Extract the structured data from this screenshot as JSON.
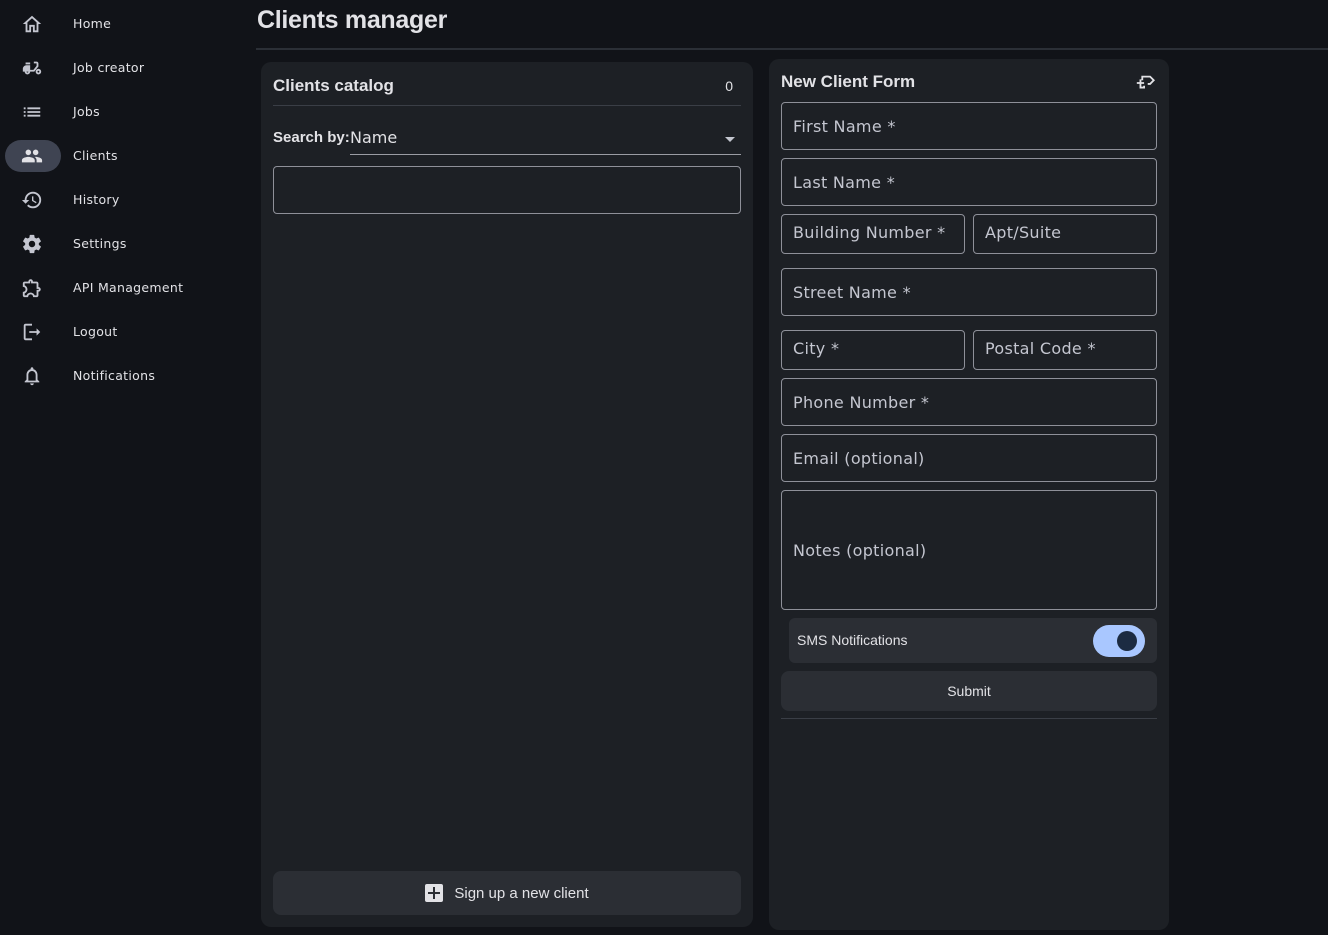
{
  "page": {
    "title": "Clients manager"
  },
  "sidebar": {
    "items": [
      {
        "label": "Home",
        "icon": "home-icon"
      },
      {
        "label": "Job creator",
        "icon": "moped-icon"
      },
      {
        "label": "Jobs",
        "icon": "list-icon"
      },
      {
        "label": "Clients",
        "icon": "people-icon",
        "active": true
      },
      {
        "label": "History",
        "icon": "history-icon"
      },
      {
        "label": "Settings",
        "icon": "gear-icon"
      },
      {
        "label": "API Management",
        "icon": "extension-icon"
      },
      {
        "label": "Logout",
        "icon": "logout-icon"
      },
      {
        "label": "Notifications",
        "icon": "bell-icon"
      }
    ]
  },
  "catalog": {
    "title": "Clients catalog",
    "count": "0",
    "search_label": "Search by:",
    "search_by": "Name",
    "search_value": "",
    "signup_label": "Sign up a new client"
  },
  "form": {
    "title": "New Client Form",
    "corner_icon": "delivery-add-icon",
    "first_name": "First Name *",
    "last_name": "Last Name *",
    "building_number": "Building Number *",
    "apt_suite": "Apt/Suite",
    "street_name": "Street Name *",
    "city": "City *",
    "postal_code": "Postal Code *",
    "phone_number": "Phone Number *",
    "email": "Email (optional)",
    "notes": "Notes (optional)",
    "sms_label": "SMS Notifications",
    "sms_enabled": true,
    "submit_label": "Submit"
  },
  "colors": {
    "background": "#111318",
    "panel": "#1d2025",
    "toggle_on": "#a9c7ff",
    "active_nav": "#3f4452"
  }
}
